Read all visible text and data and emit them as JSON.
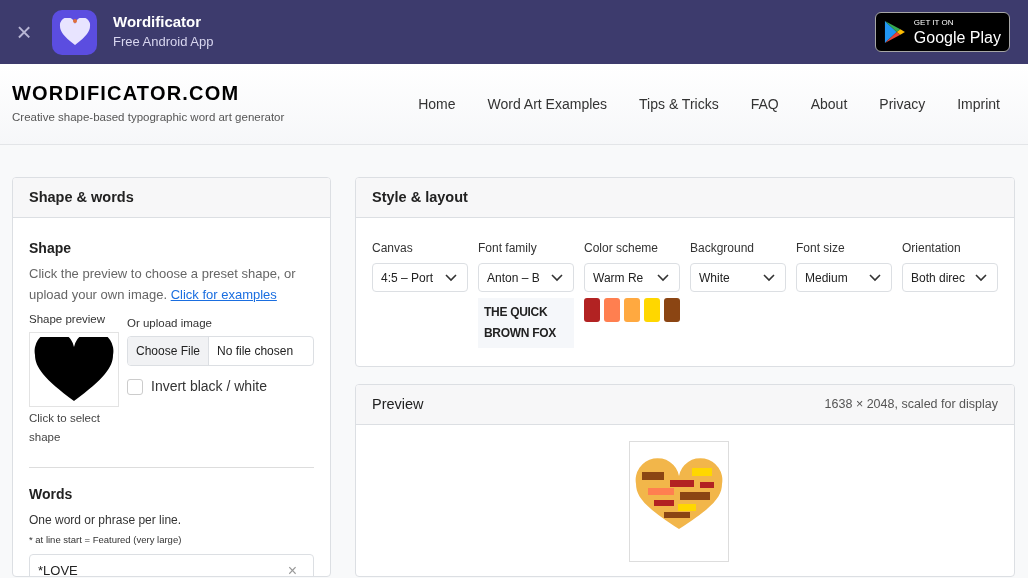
{
  "app_banner": {
    "close": "×",
    "title": "Wordificator",
    "subtitle": "Free Android App",
    "store_badge": {
      "small": "GET IT ON",
      "large": "Google Play"
    }
  },
  "header": {
    "logo": "WORDIFICATOR.COM",
    "tagline": "Creative shape-based typographic word art generator",
    "nav": [
      {
        "label": "Home"
      },
      {
        "label": "Word Art Examples"
      },
      {
        "label": "Tips & Tricks"
      },
      {
        "label": "FAQ"
      },
      {
        "label": "About"
      },
      {
        "label": "Privacy"
      },
      {
        "label": "Imprint"
      }
    ]
  },
  "shape_words": {
    "title": "Shape & words",
    "shape_heading": "Shape",
    "shape_help": "Click the preview to choose a preset shape, or upload your own image.",
    "examples_link": "Click for examples",
    "preview_label": "Shape preview",
    "preview_caption": "Click to select shape",
    "upload_label": "Or upload image",
    "choose_file": "Choose File",
    "no_file": "No file chosen",
    "invert": {
      "label": "Invert black / white",
      "checked": false
    },
    "words_heading": "Words",
    "words_help": "One word or phrase per line.",
    "words_hint": "* at line start = Featured (very large)",
    "words_text": "*LOVE",
    "clear": "×"
  },
  "style_layout": {
    "title": "Style & layout",
    "controls": [
      {
        "label": "Canvas",
        "value": "4:5 – Port"
      },
      {
        "label": "Font family",
        "value": "Anton – B",
        "sample": "THE QUICK BROWN FOX"
      },
      {
        "label": "Color scheme",
        "value": "Warm Re",
        "swatches": [
          {
            "color": "#b22222"
          },
          {
            "color": "#ff7f50"
          },
          {
            "color": "#ffa940"
          },
          {
            "color": "#ffd700"
          },
          {
            "color": "#8b4513"
          }
        ]
      },
      {
        "label": "Background",
        "value": "White"
      },
      {
        "label": "Font size",
        "value": "Medium"
      },
      {
        "label": "Orientation",
        "value": "Both direc"
      }
    ]
  },
  "preview": {
    "title": "Preview",
    "info": "1638 × 2048, scaled for display"
  }
}
